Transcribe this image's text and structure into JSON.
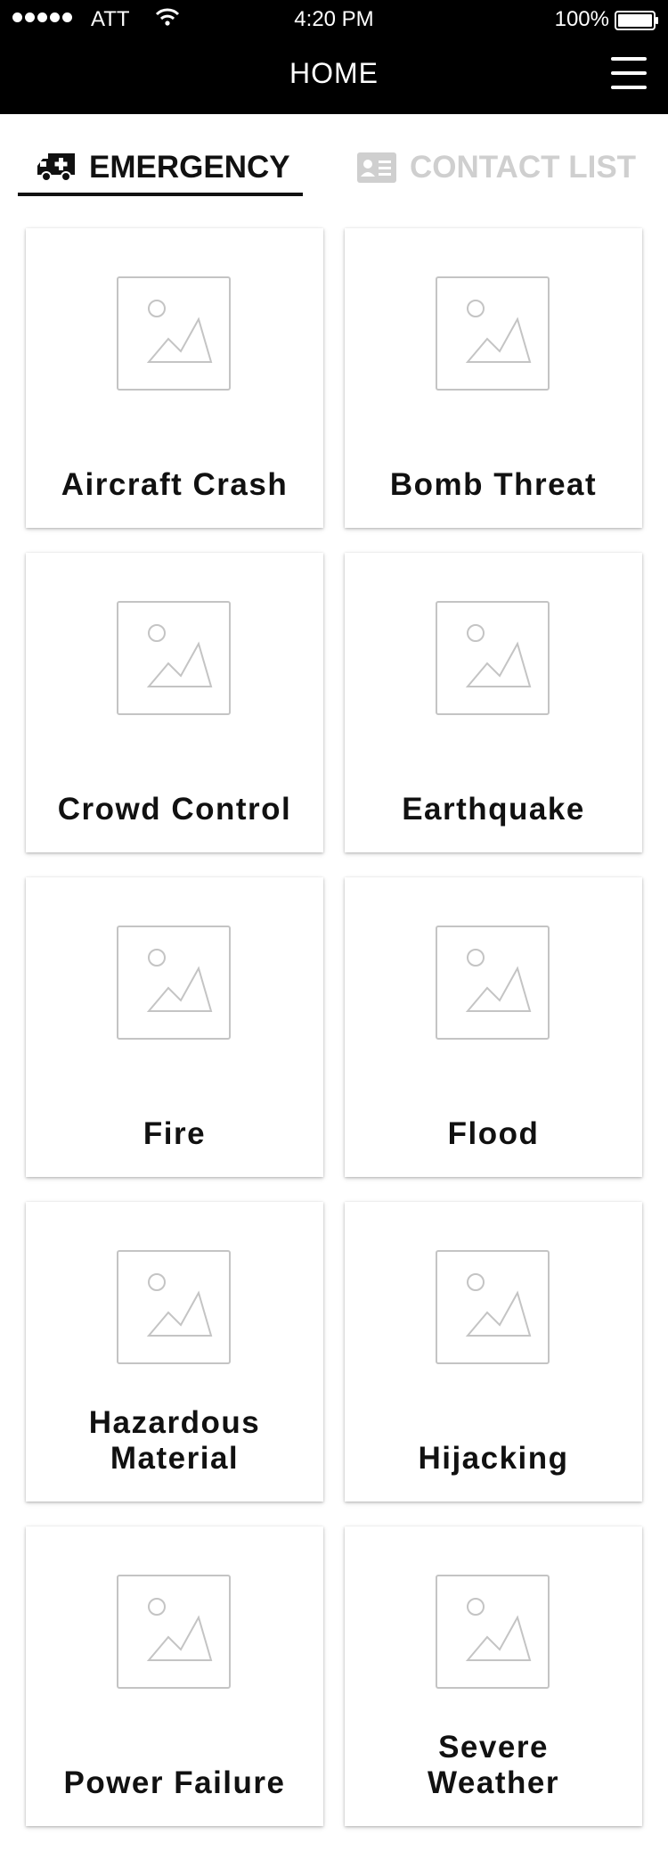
{
  "status_bar": {
    "carrier": "ATT",
    "time": "4:20 PM",
    "battery": "100%"
  },
  "header": {
    "title": "HOME"
  },
  "tabs": [
    {
      "label": "EMERGENCY",
      "icon": "ambulance-icon",
      "active": true
    },
    {
      "label": "CONTACT LIST",
      "icon": "contact-card-icon",
      "active": false
    }
  ],
  "cards": [
    {
      "label": "Aircraft Crash"
    },
    {
      "label": "Bomb Threat"
    },
    {
      "label": "Crowd Control"
    },
    {
      "label": "Earthquake"
    },
    {
      "label": "Fire"
    },
    {
      "label": "Flood"
    },
    {
      "label": "Hazardous\nMaterial"
    },
    {
      "label": "Hijacking"
    },
    {
      "label": "Power Failure"
    },
    {
      "label": "Severe\nWeather"
    }
  ]
}
